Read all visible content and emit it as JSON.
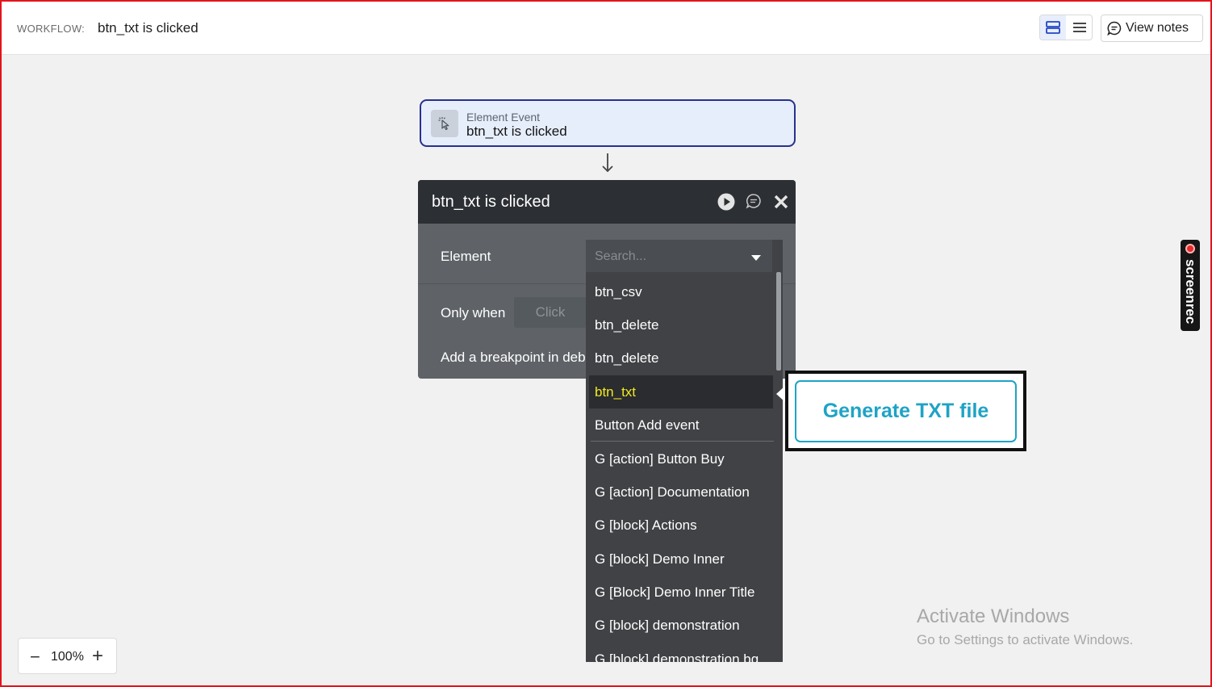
{
  "header": {
    "workflow_label": "WORKFLOW:",
    "workflow_name": "btn_txt is clicked",
    "view_notes_label": "View notes"
  },
  "event_card": {
    "type": "Element Event",
    "name": "btn_txt is clicked"
  },
  "panel": {
    "title": "btn_txt is clicked",
    "element_label": "Element",
    "only_when_label": "Only when",
    "only_when_placeholder": "Click",
    "breakpoint_label": "Add a breakpoint in deb"
  },
  "dropdown": {
    "search_placeholder": "Search...",
    "items": [
      "btn_csv",
      "btn_delete",
      "btn_delete",
      "btn_txt",
      "Button Add event",
      "G [action] Button Buy",
      "G [action] Documentation",
      "G [block] Actions",
      "G [block] Demo Inner",
      "G [Block] Demo Inner Title",
      "G [block] demonstration",
      "G [block] demonstration bg"
    ],
    "highlighted_index": 3
  },
  "callout": {
    "button_label": "Generate TXT file"
  },
  "screenrec": {
    "label": "screenrec"
  },
  "watermark": {
    "title": "Activate Windows",
    "subtitle": "Go to Settings to activate Windows."
  },
  "zoom": {
    "value": "100%",
    "minus": "−",
    "plus": "+"
  },
  "colors": {
    "accent_blue": "#27318f",
    "highlight_yellow": "#f2ea1f",
    "callout_teal": "#1ea3c6",
    "frame_red": "#e3131b"
  }
}
